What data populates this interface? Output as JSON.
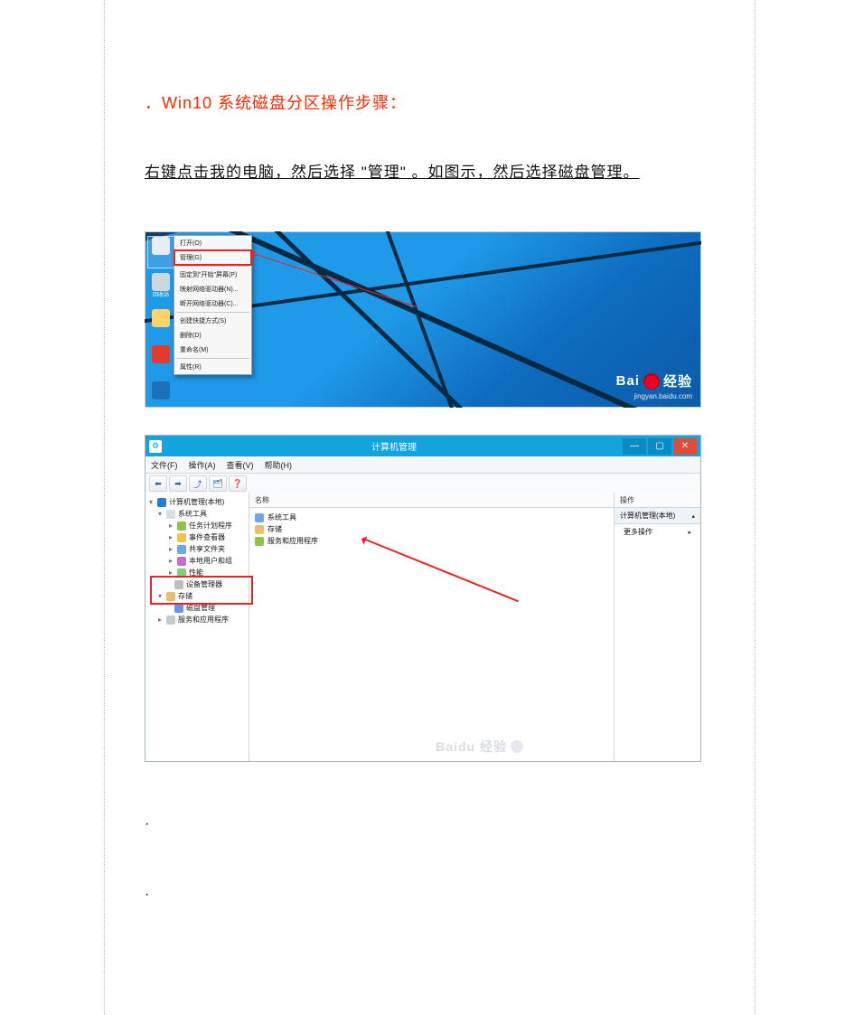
{
  "doc": {
    "heading": "．Win10 系统磁盘分区操作步骤：",
    "step_text": "右键点击我的电脑，然后选择 \"管理\" 。如图示，然后选择磁盘管理。",
    "dot1": "·",
    "dot2": "·"
  },
  "shot1": {
    "desktop_icons": [
      {
        "label": "回收站",
        "cls": "g-trash"
      },
      {
        "label": "",
        "cls": "g-generic"
      },
      {
        "label": "",
        "cls": "g-folder"
      },
      {
        "label": "",
        "cls": "g-qq"
      },
      {
        "label": "",
        "cls": "g-edge"
      }
    ],
    "context_menu": [
      "打开(O)",
      "管理(G)",
      "---",
      "固定到\"开始\"屏幕(P)",
      "映射网络驱动器(N)...",
      "断开网络驱动器(C)...",
      "---",
      "创建快捷方式(S)",
      "删除(D)",
      "重命名(M)",
      "---",
      "属性(R)"
    ],
    "watermark": {
      "logo": "Bai",
      "logo2": "经验",
      "sub": "jingyan.baidu.com"
    }
  },
  "shot2": {
    "title": "计算机管理",
    "menubar": [
      "文件(F)",
      "操作(A)",
      "查看(V)",
      "帮助(H)"
    ],
    "toolbar_icons": [
      "⬅",
      "➡",
      "⤴",
      "🗂",
      "❓"
    ],
    "tree": {
      "root": "计算机管理(本地)",
      "sys": "系统工具",
      "task": "任务计划程序",
      "event": "事件查看器",
      "share": "共享文件夹",
      "users": "本地用户和组",
      "perf": "性能",
      "dev": "设备管理器",
      "storage": "存储",
      "disk": "磁盘管理",
      "svc": "服务和应用程序"
    },
    "mid": {
      "header": "名称",
      "items": [
        "系统工具",
        "存储",
        "服务和应用程序"
      ]
    },
    "actions": {
      "header": "操作",
      "row1": "计算机管理(本地)",
      "row2": "更多操作"
    },
    "watermark": "Baidu 经验"
  }
}
